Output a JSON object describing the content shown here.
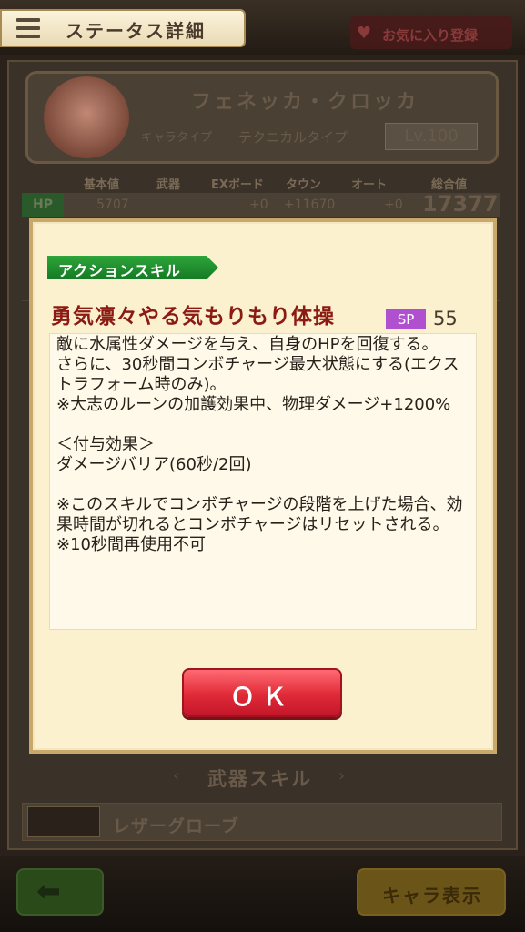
{
  "header": {
    "title": "ステータス詳細",
    "favorite_label": "お気に入り登録"
  },
  "character": {
    "name": "フェネッカ・クロッカ",
    "type_label": "キャラタイプ",
    "type_value": "テクニカルタイプ",
    "level": "Lv.100"
  },
  "stats": {
    "headers": [
      "基本値",
      "武器",
      "EXボード",
      "タウン",
      "オート",
      "総合値"
    ],
    "hp_label": "HP",
    "hp_values": [
      "5707",
      "+0",
      "+11670",
      "+0"
    ],
    "hp_total": "17377"
  },
  "dialog": {
    "tag": "アクションスキル",
    "skill_name": "勇気凛々やる気もりもり体操",
    "sp_label": "SP",
    "sp_value": "55",
    "description": "敵に水属性ダメージを与え、自身のHPを回復する。\nさらに、30秒間コンボチャージ最大状態にする(エクストラフォーム時のみ)。\n※大志のルーンの加護効果中、物理ダメージ+1200%\n\n＜付与効果＞\nダメージバリア(60秒/2回)\n\n※このスキルでコンボチャージの段階を上げた場合、効果時間が切れるとコンボチャージはリセットされる。\n※10秒間再使用不可",
    "ok_label": "ＯＫ"
  },
  "weapon_skill": {
    "header": "武器スキル",
    "weapon_name": "レザーグローブ"
  },
  "footer": {
    "back_icon": "back-arrow-icon",
    "char_display_label": "キャラ表示"
  }
}
